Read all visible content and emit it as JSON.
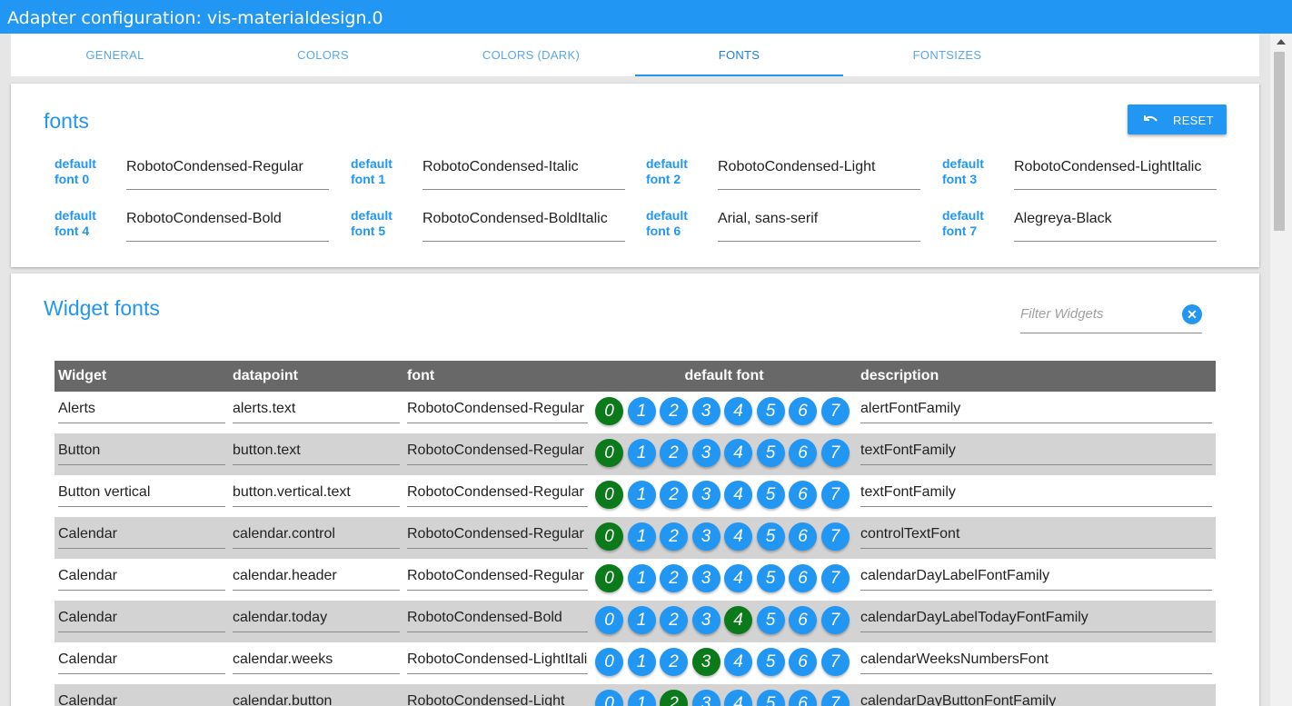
{
  "window": {
    "title": "Adapter configuration: vis-materialdesign.0"
  },
  "tabs": [
    {
      "label": "GENERAL"
    },
    {
      "label": "COLORS"
    },
    {
      "label": "COLORS (DARK)"
    },
    {
      "label": "FONTS",
      "active": true
    },
    {
      "label": "FONTSIZES"
    }
  ],
  "fonts_card": {
    "title": "fonts",
    "reset_label": "RESET",
    "fields": [
      {
        "label": "default font 0",
        "value": "RobotoCondensed-Regular"
      },
      {
        "label": "default font 1",
        "value": "RobotoCondensed-Italic"
      },
      {
        "label": "default font 2",
        "value": "RobotoCondensed-Light"
      },
      {
        "label": "default font 3",
        "value": "RobotoCondensed-LightItalic"
      },
      {
        "label": "default font 4",
        "value": "RobotoCondensed-Bold"
      },
      {
        "label": "default font 5",
        "value": "RobotoCondensed-BoldItalic"
      },
      {
        "label": "default font 6",
        "value": "Arial, sans-serif"
      },
      {
        "label": "default font 7",
        "value": "Alegreya-Black"
      }
    ]
  },
  "widget_card": {
    "title": "Widget fonts",
    "filter_placeholder": "Filter Widgets",
    "columns": [
      "Widget",
      "datapoint",
      "font",
      "default font",
      "description"
    ],
    "font_buttons": [
      "0",
      "1",
      "2",
      "3",
      "4",
      "5",
      "6",
      "7"
    ],
    "rows": [
      {
        "widget": "Alerts",
        "datapoint": "alerts.text",
        "font": "RobotoCondensed-Regular",
        "selected": 0,
        "description": "alertFontFamily"
      },
      {
        "widget": "Button",
        "datapoint": "button.text",
        "font": "RobotoCondensed-Regular",
        "selected": 0,
        "description": "textFontFamily"
      },
      {
        "widget": "Button vertical",
        "datapoint": "button.vertical.text",
        "font": "RobotoCondensed-Regular",
        "selected": 0,
        "description": "textFontFamily"
      },
      {
        "widget": "Calendar",
        "datapoint": "calendar.control",
        "font": "RobotoCondensed-Regular",
        "selected": 0,
        "description": "controlTextFont"
      },
      {
        "widget": "Calendar",
        "datapoint": "calendar.header",
        "font": "RobotoCondensed-Regular",
        "selected": 0,
        "description": "calendarDayLabelFontFamily"
      },
      {
        "widget": "Calendar",
        "datapoint": "calendar.today",
        "font": "RobotoCondensed-Bold",
        "selected": 4,
        "description": "calendarDayLabelTodayFontFamily"
      },
      {
        "widget": "Calendar",
        "datapoint": "calendar.weeks",
        "font": "RobotoCondensed-LightItali",
        "selected": 3,
        "description": "calendarWeeksNumbersFont"
      },
      {
        "widget": "Calendar",
        "datapoint": "calendar.button",
        "font": "RobotoCondensed-Light",
        "selected": 2,
        "description": "calendarDayButtonFontFamily"
      }
    ]
  },
  "colors": {
    "accent": "#2196f3",
    "selected": "#0a7a1a",
    "header_bg": "#686868",
    "row_alt": "#d3d3d3"
  }
}
